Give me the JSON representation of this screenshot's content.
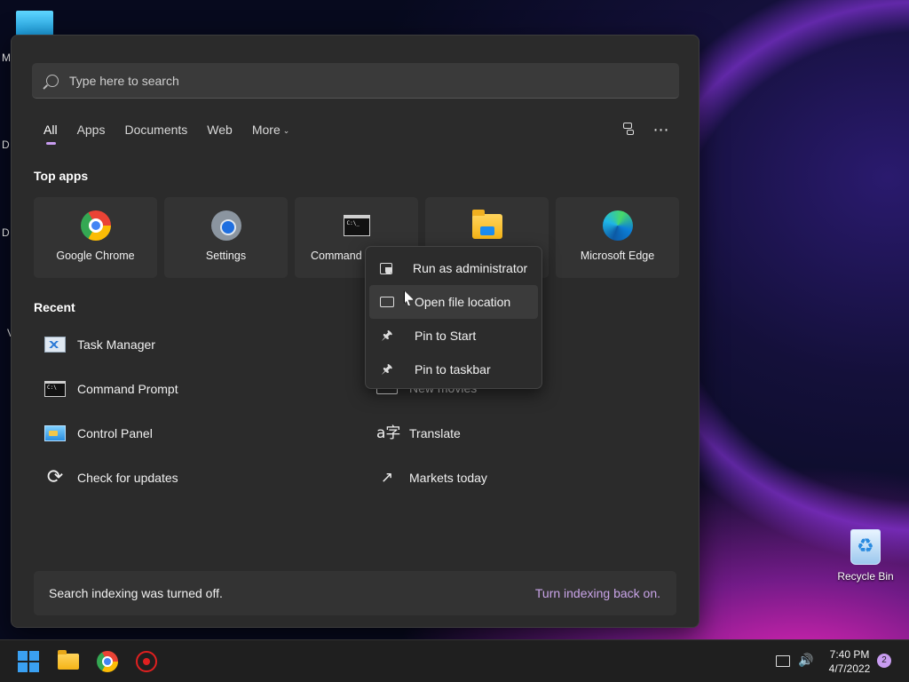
{
  "desktop": {
    "side_letters": [
      "M",
      "D",
      "D",
      "V"
    ],
    "recycle_bin_label": "Recycle Bin"
  },
  "search": {
    "placeholder": "Type here to search",
    "value": ""
  },
  "tabs": [
    {
      "label": "All",
      "active": true
    },
    {
      "label": "Apps"
    },
    {
      "label": "Documents"
    },
    {
      "label": "Web"
    },
    {
      "label": "More"
    }
  ],
  "top_apps": {
    "title": "Top apps",
    "items": [
      {
        "label": "Google Chrome",
        "icon": "chrome-icon"
      },
      {
        "label": "Settings",
        "icon": "gear-icon"
      },
      {
        "label": "Command",
        "icon": "terminal-icon"
      },
      {
        "label": "",
        "icon": "folder-icon"
      },
      {
        "label": "Microsoft Edge",
        "icon": "edge-icon"
      }
    ]
  },
  "recent": {
    "title": "Recent",
    "left": [
      {
        "label": "Task Manager",
        "icon": "task-manager-icon"
      },
      {
        "label": "Command Prompt",
        "icon": "terminal-icon"
      },
      {
        "label": "Control Panel",
        "icon": "control-panel-icon"
      },
      {
        "label": "Check for updates",
        "icon": "refresh-icon"
      }
    ],
    "right": [
      {
        "label": "New movies",
        "icon": "movie-icon"
      },
      {
        "label": "Translate",
        "icon": "translate-icon"
      },
      {
        "label": "Markets today",
        "icon": "chart-icon"
      }
    ]
  },
  "context_menu": {
    "items": [
      {
        "label": "Run as administrator",
        "icon": "shield-icon"
      },
      {
        "label": "Open file location",
        "icon": "folder-icon"
      },
      {
        "label": "Pin to Start",
        "icon": "pin-icon"
      },
      {
        "label": "Pin to taskbar",
        "icon": "pin-icon"
      }
    ]
  },
  "banner": {
    "message": "Search indexing was turned off.",
    "link": "Turn indexing back on."
  },
  "taskbar": {
    "time": "7:40 PM",
    "date": "4/7/2022",
    "notification_count": "2"
  }
}
